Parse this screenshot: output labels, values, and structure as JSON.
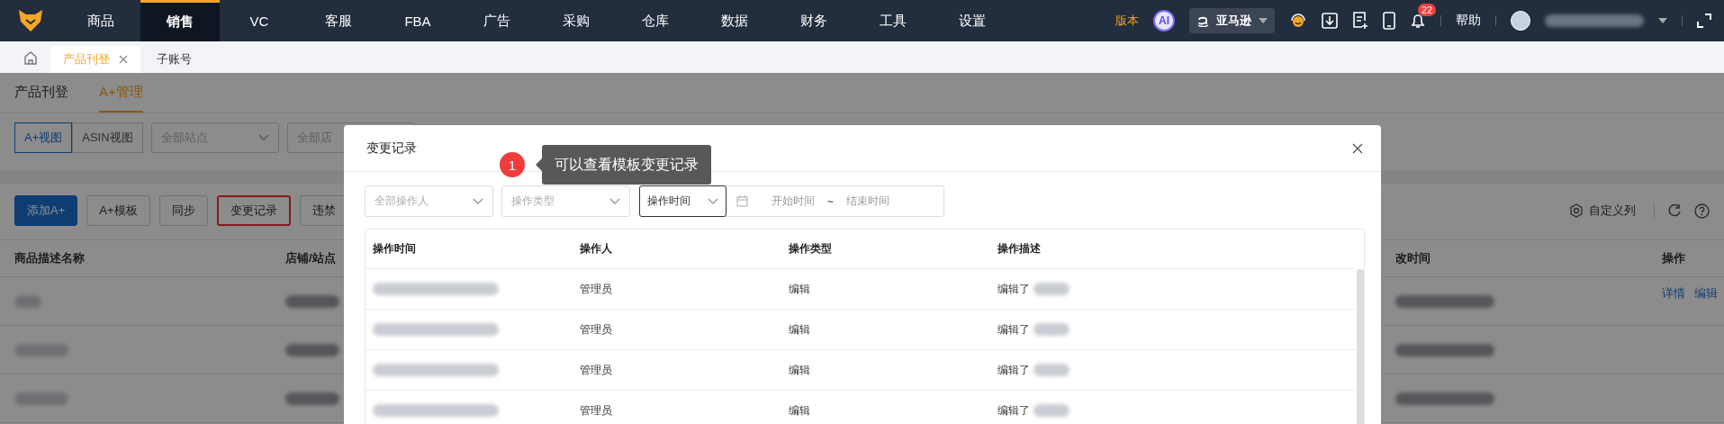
{
  "nav": {
    "items": [
      {
        "label": "商品",
        "selected": false
      },
      {
        "label": "销售",
        "selected": true
      },
      {
        "label": "VC",
        "selected": false
      },
      {
        "label": "客服",
        "selected": false
      },
      {
        "label": "FBA",
        "selected": false
      },
      {
        "label": "广告",
        "selected": false
      },
      {
        "label": "采购",
        "selected": false
      },
      {
        "label": "仓库",
        "selected": false
      },
      {
        "label": "数据",
        "selected": false
      },
      {
        "label": "财务",
        "selected": false
      },
      {
        "label": "工具",
        "selected": false
      },
      {
        "label": "设置",
        "selected": false
      }
    ],
    "edition": "版本",
    "ai": "AI",
    "store": "亚马逊",
    "notifications": "22",
    "help": "帮助"
  },
  "tabs": [
    {
      "label": "产品刊登",
      "selected": true,
      "closable": true
    },
    {
      "label": "子账号",
      "selected": false,
      "closable": false
    }
  ],
  "subtabs": [
    {
      "label": "产品刊登",
      "selected": false
    },
    {
      "label": "A+管理",
      "selected": true
    }
  ],
  "view_toggle": [
    {
      "label": "A+视图",
      "selected": true
    },
    {
      "label": "ASIN视图",
      "selected": false
    }
  ],
  "filters": [
    {
      "placeholder": "全部站点"
    },
    {
      "placeholder": "全部店"
    }
  ],
  "toolbar": {
    "buttons": [
      {
        "label": "添加A+",
        "kind": "primary",
        "highlighted": false
      },
      {
        "label": "A+模板",
        "kind": "default",
        "highlighted": false
      },
      {
        "label": "同步",
        "kind": "default",
        "highlighted": false
      },
      {
        "label": "变更记录",
        "kind": "default",
        "highlighted": true
      },
      {
        "label": "违禁",
        "kind": "default",
        "highlighted": false
      }
    ],
    "customize": "自定义列"
  },
  "table": {
    "columns": [
      "商品描述名称",
      "店铺/站点",
      "改时间",
      "操作"
    ],
    "row_actions": [
      "详情",
      "编辑"
    ]
  },
  "modal": {
    "title": "变更记录",
    "filters": [
      {
        "placeholder": "全部操作人"
      },
      {
        "placeholder": "操作类型"
      }
    ],
    "time_type": "操作时间",
    "date_start": "开始时间",
    "date_separator": "~",
    "date_end": "结束时间",
    "columns": [
      "操作时间",
      "操作人",
      "操作类型",
      "操作描述"
    ],
    "rows": [
      {
        "operator": "管理员",
        "type": "编辑",
        "description": "编辑了"
      },
      {
        "operator": "管理员",
        "type": "编辑",
        "description": "编辑了"
      },
      {
        "operator": "管理员",
        "type": "编辑",
        "description": "编辑了"
      },
      {
        "operator": "管理员",
        "type": "编辑",
        "description": "编辑了"
      }
    ]
  },
  "tooltip": {
    "step": "1",
    "text": "可以查看模板变更记录"
  }
}
